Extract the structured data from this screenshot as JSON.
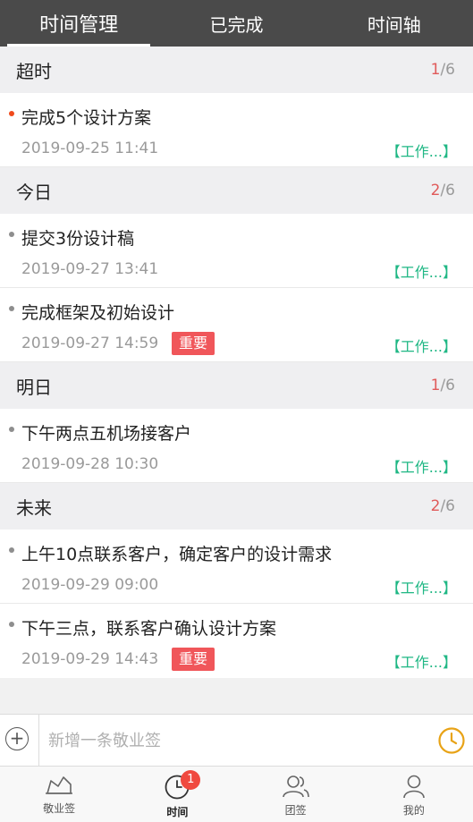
{
  "tabs": [
    "时间管理",
    "已完成",
    "时间轴"
  ],
  "sections": [
    {
      "title": "超时",
      "done": "1",
      "total": "/6",
      "items": [
        {
          "title": "完成5个设计方案",
          "time": "2019-09-25 11:41",
          "tag": "【工作...】"
        }
      ]
    },
    {
      "title": "今日",
      "done": "2",
      "total": "/6",
      "items": [
        {
          "title": "提交3份设计稿",
          "time": "2019-09-27 13:41",
          "tag": "【工作...】"
        },
        {
          "title": "完成框架及初始设计",
          "time": "2019-09-27 14:59",
          "badge": "重要",
          "tag": "【工作...】"
        }
      ]
    },
    {
      "title": "明日",
      "done": "1",
      "total": "/6",
      "items": [
        {
          "title": "下午两点五机场接客户",
          "time": "2019-09-28 10:30",
          "tag": "【工作...】"
        }
      ]
    },
    {
      "title": "未来",
      "done": "2",
      "total": "/6",
      "items": [
        {
          "title": "上午10点联系客户，确定客户的设计需求",
          "time": "2019-09-29 09:00",
          "tag": "【工作...】"
        },
        {
          "title": "下午三点，联系客户确认设计方案",
          "time": "2019-09-29 14:43",
          "badge": "重要",
          "tag": "【工作...】"
        }
      ]
    }
  ],
  "input": {
    "placeholder": "新增一条敬业签",
    "plus": "+"
  },
  "nav": [
    {
      "label": "敬业签",
      "icon": "note-icon"
    },
    {
      "label": "时间",
      "icon": "clock-icon",
      "badge": "1"
    },
    {
      "label": "团签",
      "icon": "team-icon"
    },
    {
      "label": "我的",
      "icon": "user-icon"
    }
  ],
  "colors": {
    "header_bg": "#4a4a4a",
    "overdue_dot": "#f04a1c",
    "tag_green": "#1fb784",
    "badge_red": "#f0565a",
    "clock_orange": "#e8a317",
    "nav_badge": "#f0493f"
  }
}
